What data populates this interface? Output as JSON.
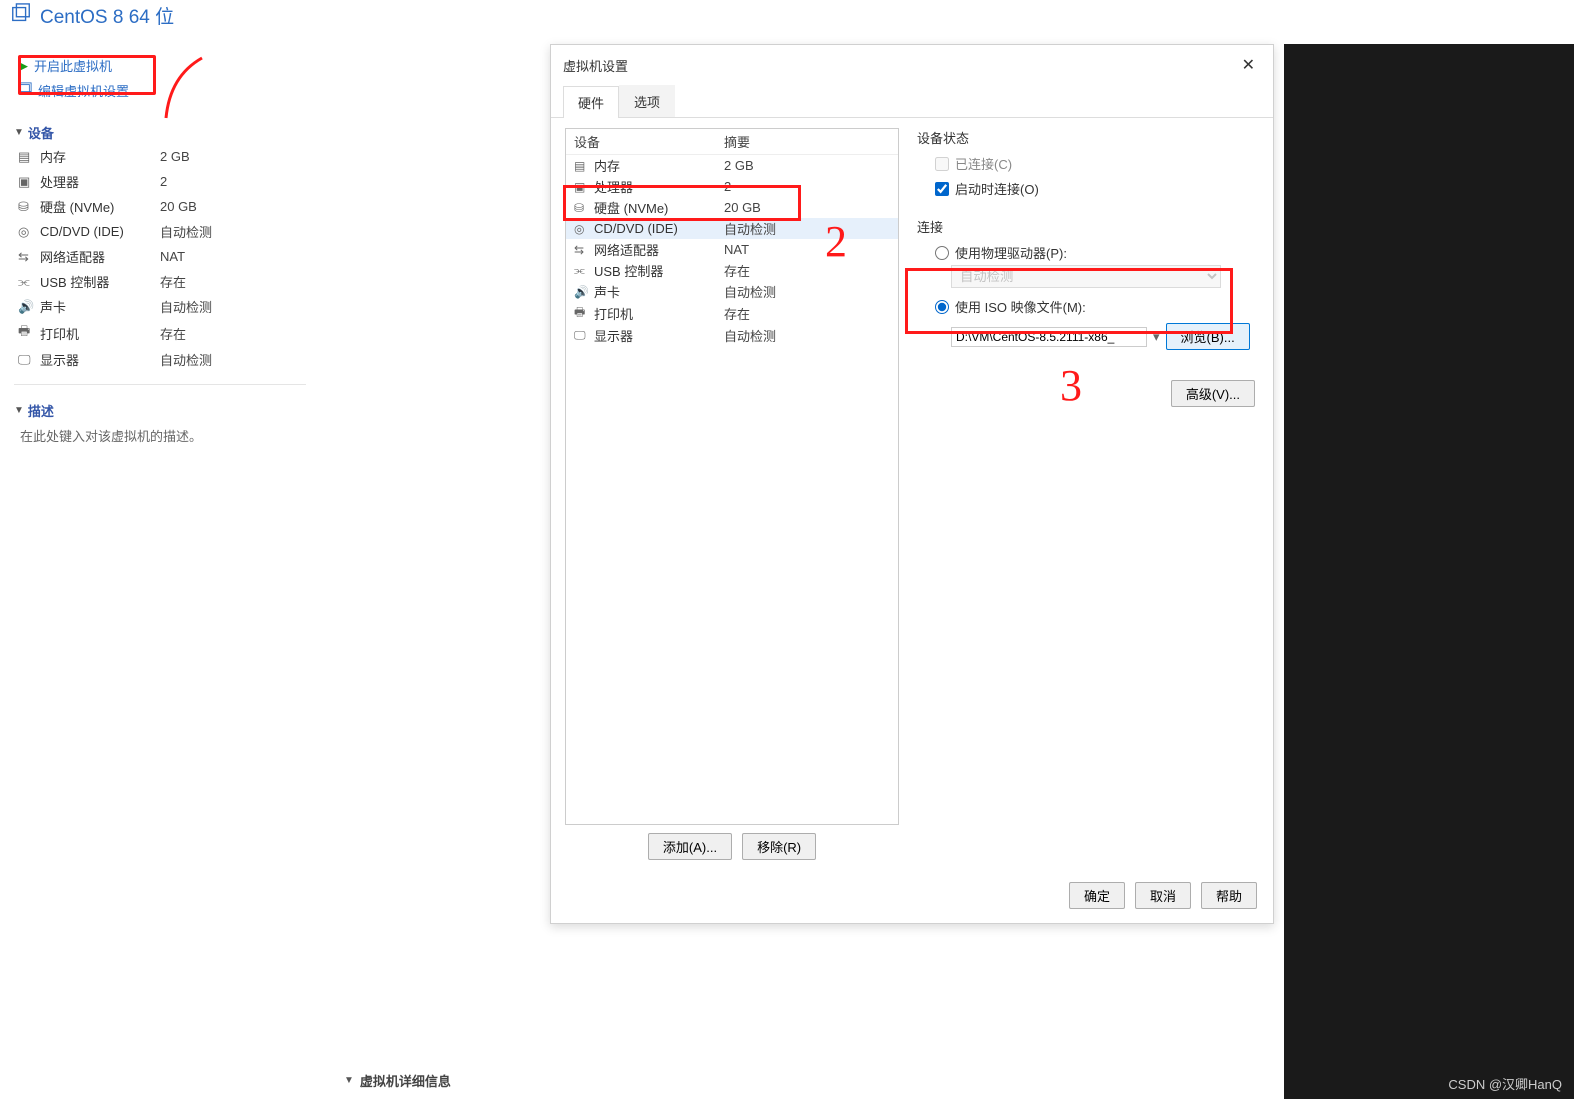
{
  "header": {
    "vm_title": "CentOS 8 64 位"
  },
  "actions": {
    "power_on": "开启此虚拟机",
    "edit_settings": "编辑虚拟机设置"
  },
  "sections": {
    "devices": "设备",
    "description": "描述",
    "detail": "虚拟机详细信息"
  },
  "desc_placeholder": "在此处键入对该虚拟机的描述。",
  "sidebar_devices": [
    {
      "icon": "mem",
      "name": "内存",
      "summary": "2 GB"
    },
    {
      "icon": "cpu",
      "name": "处理器",
      "summary": "2"
    },
    {
      "icon": "hdd",
      "name": "硬盘 (NVMe)",
      "summary": "20 GB"
    },
    {
      "icon": "cd",
      "name": "CD/DVD (IDE)",
      "summary": "自动检测"
    },
    {
      "icon": "net",
      "name": "网络适配器",
      "summary": "NAT"
    },
    {
      "icon": "usb",
      "name": "USB 控制器",
      "summary": "存在"
    },
    {
      "icon": "snd",
      "name": "声卡",
      "summary": "自动检测"
    },
    {
      "icon": "prn",
      "name": "打印机",
      "summary": "存在"
    },
    {
      "icon": "dsp",
      "name": "显示器",
      "summary": "自动检测"
    }
  ],
  "dialog": {
    "title": "虚拟机设置",
    "tabs": {
      "hardware": "硬件",
      "options": "选项"
    },
    "table_head": {
      "device": "设备",
      "summary": "摘要"
    },
    "devices": [
      {
        "icon": "mem",
        "name": "内存",
        "summary": "2 GB"
      },
      {
        "icon": "cpu",
        "name": "处理器",
        "summary": "2"
      },
      {
        "icon": "hdd",
        "name": "硬盘 (NVMe)",
        "summary": "20 GB"
      },
      {
        "icon": "cd",
        "name": "CD/DVD (IDE)",
        "summary": "自动检测"
      },
      {
        "icon": "net",
        "name": "网络适配器",
        "summary": "NAT"
      },
      {
        "icon": "usb",
        "name": "USB 控制器",
        "summary": "存在"
      },
      {
        "icon": "snd",
        "name": "声卡",
        "summary": "自动检测"
      },
      {
        "icon": "prn",
        "name": "打印机",
        "summary": "存在"
      },
      {
        "icon": "dsp",
        "name": "显示器",
        "summary": "自动检测"
      }
    ],
    "buttons": {
      "add": "添加(A)...",
      "remove": "移除(R)"
    },
    "footer": {
      "ok": "确定",
      "cancel": "取消",
      "help": "帮助"
    },
    "right": {
      "status_title": "设备状态",
      "connected": "已连接(C)",
      "connect_on": "启动时连接(O)",
      "conn_title": "连接",
      "use_physical": "使用物理驱动器(P):",
      "auto_detect": "自动检测",
      "use_iso": "使用 ISO 映像文件(M):",
      "iso_path": "D:\\VM\\CentOS-8.5.2111-x86_",
      "browse": "浏览(B)...",
      "advanced": "高级(V)..."
    }
  },
  "annotations": {
    "two": "2",
    "three": "3"
  },
  "watermark": "CSDN @汉卿HanQ"
}
